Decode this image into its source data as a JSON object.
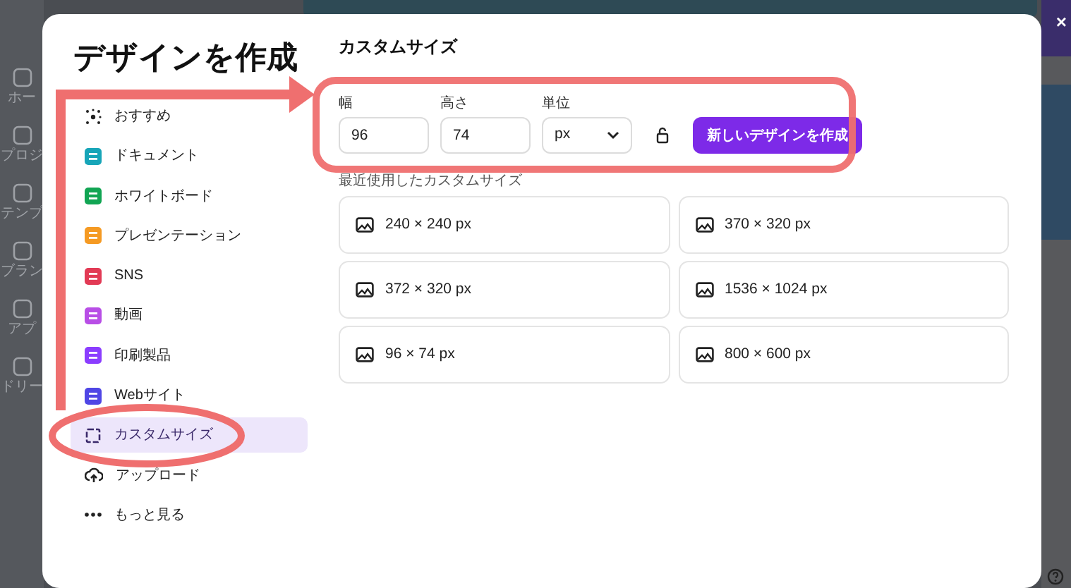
{
  "app_rail": {
    "items": [
      {
        "label": "ホー"
      },
      {
        "label": "プロジ"
      },
      {
        "label": "テンプ"
      },
      {
        "label": "ブラン"
      },
      {
        "label": "アプ"
      },
      {
        "label": "ドリー"
      }
    ]
  },
  "close_label": "×",
  "dialog": {
    "title": "デザインを作成",
    "categories": [
      {
        "label": "おすすめ",
        "kind": "sparkle",
        "color": "#222222",
        "selected": false
      },
      {
        "label": "ドキュメント",
        "kind": "tile",
        "color": "#17a5b8",
        "selected": false
      },
      {
        "label": "ホワイトボード",
        "kind": "tile",
        "color": "#11a553",
        "selected": false
      },
      {
        "label": "プレゼンテーション",
        "kind": "tile",
        "color": "#f59a23",
        "selected": false
      },
      {
        "label": "SNS",
        "kind": "tile",
        "color": "#e23a55",
        "selected": false
      },
      {
        "label": "動画",
        "kind": "tile",
        "color": "#b84ee6",
        "selected": false
      },
      {
        "label": "印刷製品",
        "kind": "tile",
        "color": "#8b3dff",
        "selected": false
      },
      {
        "label": "Webサイト",
        "kind": "tile",
        "color": "#4f46e5",
        "selected": false
      },
      {
        "label": "カスタムサイズ",
        "kind": "outline",
        "color": "#3b2a6b",
        "selected": true
      },
      {
        "label": "アップロード",
        "kind": "upload",
        "color": "#222222",
        "selected": false
      },
      {
        "label": "もっと見る",
        "kind": "more",
        "color": "#222222",
        "selected": false
      }
    ],
    "custom_size": {
      "heading": "カスタムサイズ",
      "width": {
        "label": "幅",
        "value": "96"
      },
      "height": {
        "label": "高さ",
        "value": "74"
      },
      "unit": {
        "label": "単位",
        "value": "px"
      },
      "locked": false,
      "create_button": "新しいデザインを作成",
      "recent_label": "最近使用したカスタムサイズ",
      "recent": [
        "240 × 240 px",
        "370 × 320 px",
        "372 × 320 px",
        "1536 × 1024 px",
        "96 × 74 px",
        "800 × 600 px"
      ]
    }
  }
}
